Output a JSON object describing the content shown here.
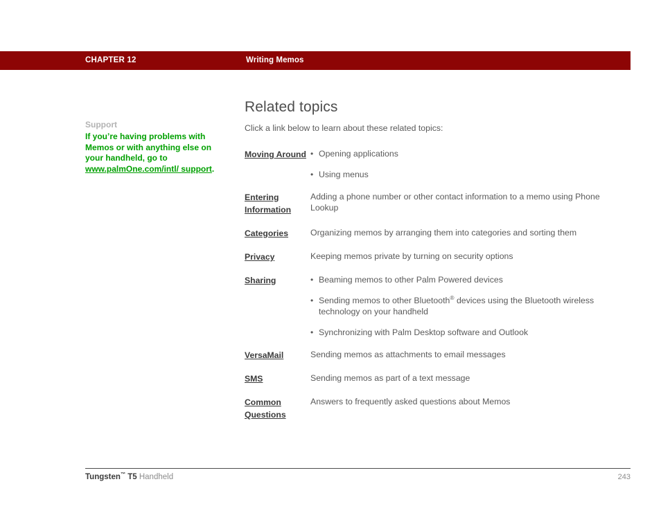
{
  "header": {
    "chapter": "CHAPTER 12",
    "title": "Writing Memos",
    "bar_color": "#8d0505"
  },
  "sidebar": {
    "heading": "Support",
    "body_before_link": "If you’re having problems with Memos or with anything else on your handheld, go to ",
    "link_text": "www.palmOne.com/intl/ support",
    "body_after_link": ".",
    "link_color": "#00a000"
  },
  "main": {
    "page_title": "Related topics",
    "intro": "Click a link below to learn about these related topics:",
    "topics": [
      {
        "link": "Moving Around",
        "bullets": [
          "Opening applications",
          "Using menus"
        ]
      },
      {
        "link": "Entering Information",
        "description": "Adding a phone number or other contact information to a memo using Phone Lookup"
      },
      {
        "link": "Categories",
        "description": "Organizing memos by arranging them into categories and sorting them"
      },
      {
        "link": "Privacy",
        "description": "Keeping memos private by turning on security options"
      },
      {
        "link": "Sharing",
        "bullets": [
          "Beaming memos to other Palm Powered devices",
          "Sending memos to other Bluetooth® devices using the Bluetooth wireless technology on your handheld",
          "Synchronizing with Palm Desktop software and Outlook"
        ],
        "bullet_sup_index": 1
      },
      {
        "link": "VersaMail",
        "description": "Sending memos as attachments to email messages"
      },
      {
        "link": "SMS",
        "description": "Sending memos as part of a text message"
      },
      {
        "link": "Common Questions",
        "description": "Answers to frequently asked questions about Memos"
      }
    ]
  },
  "footer": {
    "brand": "Tungsten",
    "brand_tm": "™",
    "model": " T5",
    "product": " Handheld",
    "page_number": "243"
  }
}
